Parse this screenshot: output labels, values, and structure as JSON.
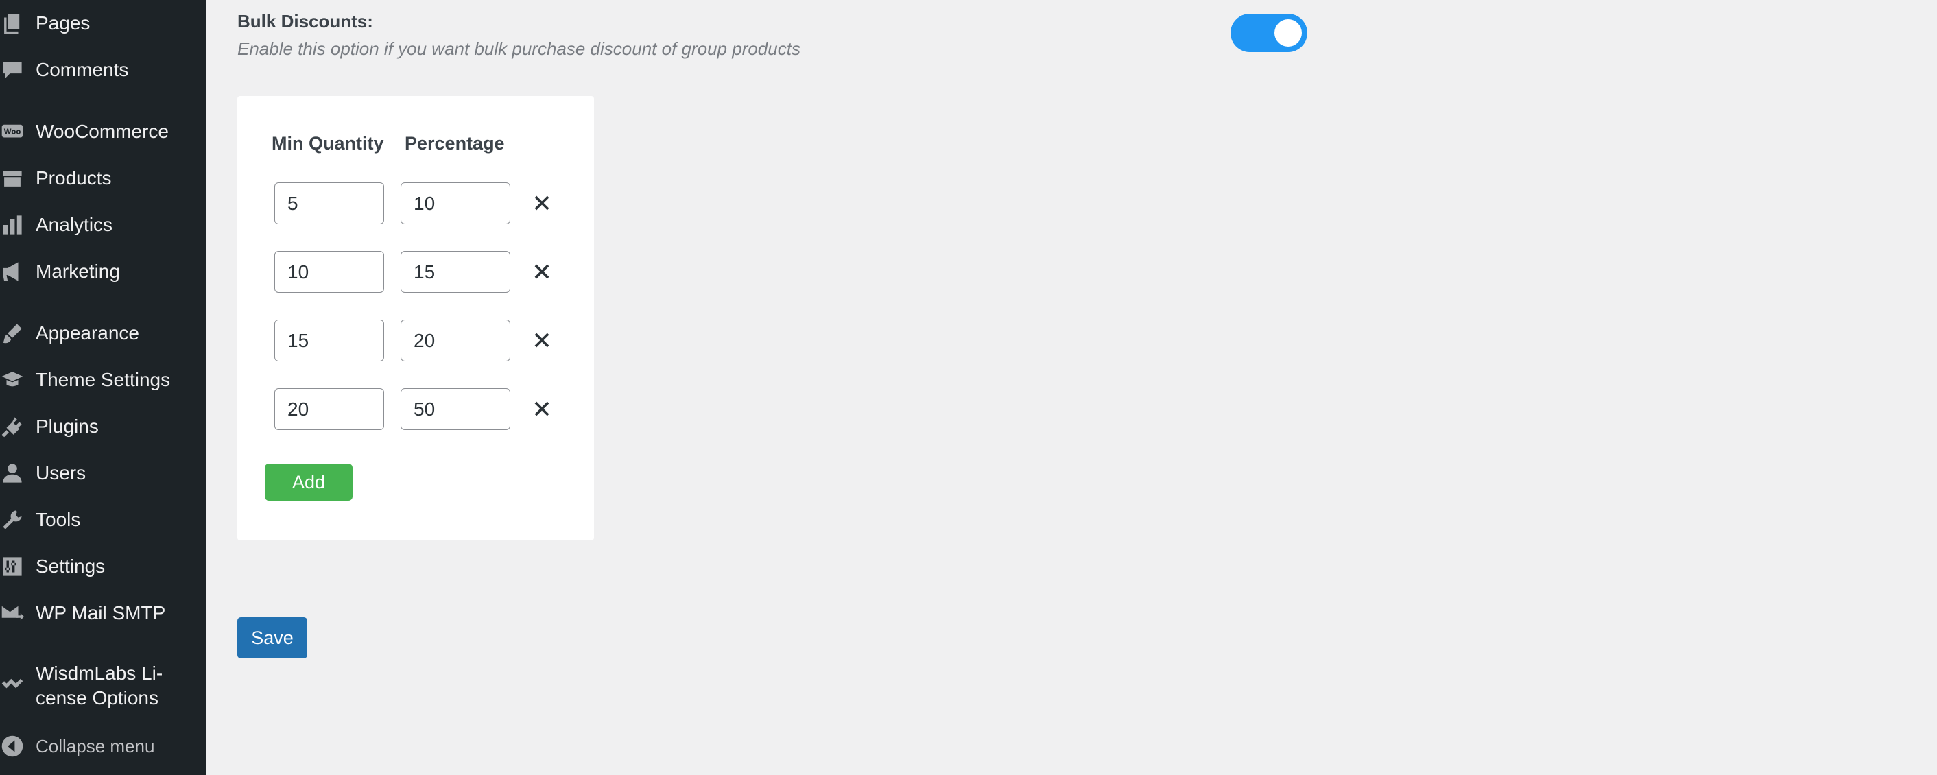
{
  "sidebar": {
    "items": [
      {
        "label": "Pages",
        "icon": "pages-icon"
      },
      {
        "label": "Comments",
        "icon": "comments-icon"
      },
      {
        "label": "WooCommerce",
        "icon": "woocommerce-icon"
      },
      {
        "label": "Products",
        "icon": "products-icon"
      },
      {
        "label": "Analytics",
        "icon": "analytics-icon"
      },
      {
        "label": "Marketing",
        "icon": "megaphone-icon"
      },
      {
        "label": "Appearance",
        "icon": "paintbrush-icon"
      },
      {
        "label": "Theme Settings",
        "icon": "graduation-cap-icon"
      },
      {
        "label": "Plugins",
        "icon": "plug-icon"
      },
      {
        "label": "Users",
        "icon": "user-icon"
      },
      {
        "label": "Tools",
        "icon": "wrench-icon"
      },
      {
        "label": "Settings",
        "icon": "sliders-icon"
      },
      {
        "label": "WP Mail SMTP",
        "icon": "mail-icon"
      },
      {
        "label": "WisdmLabs Li-cense Options",
        "icon": "chevron-check-icon"
      }
    ],
    "collapse_label": "Collapse menu"
  },
  "bulk": {
    "title": "Bulk Discounts:",
    "description": "Enable this option if you want bulk purchase discount of group products",
    "enabled": true
  },
  "table": {
    "col_min": "Min Quantity",
    "col_pct": "Percentage",
    "rows": [
      {
        "min": "5",
        "pct": "10"
      },
      {
        "min": "10",
        "pct": "15"
      },
      {
        "min": "15",
        "pct": "20"
      },
      {
        "min": "20",
        "pct": "50"
      }
    ]
  },
  "buttons": {
    "add": "Add",
    "save": "Save"
  },
  "colors": {
    "sidebar_bg": "#1d2327",
    "toggle_on": "#2196f3",
    "add_green": "#46b450",
    "save_blue": "#2271b1"
  }
}
